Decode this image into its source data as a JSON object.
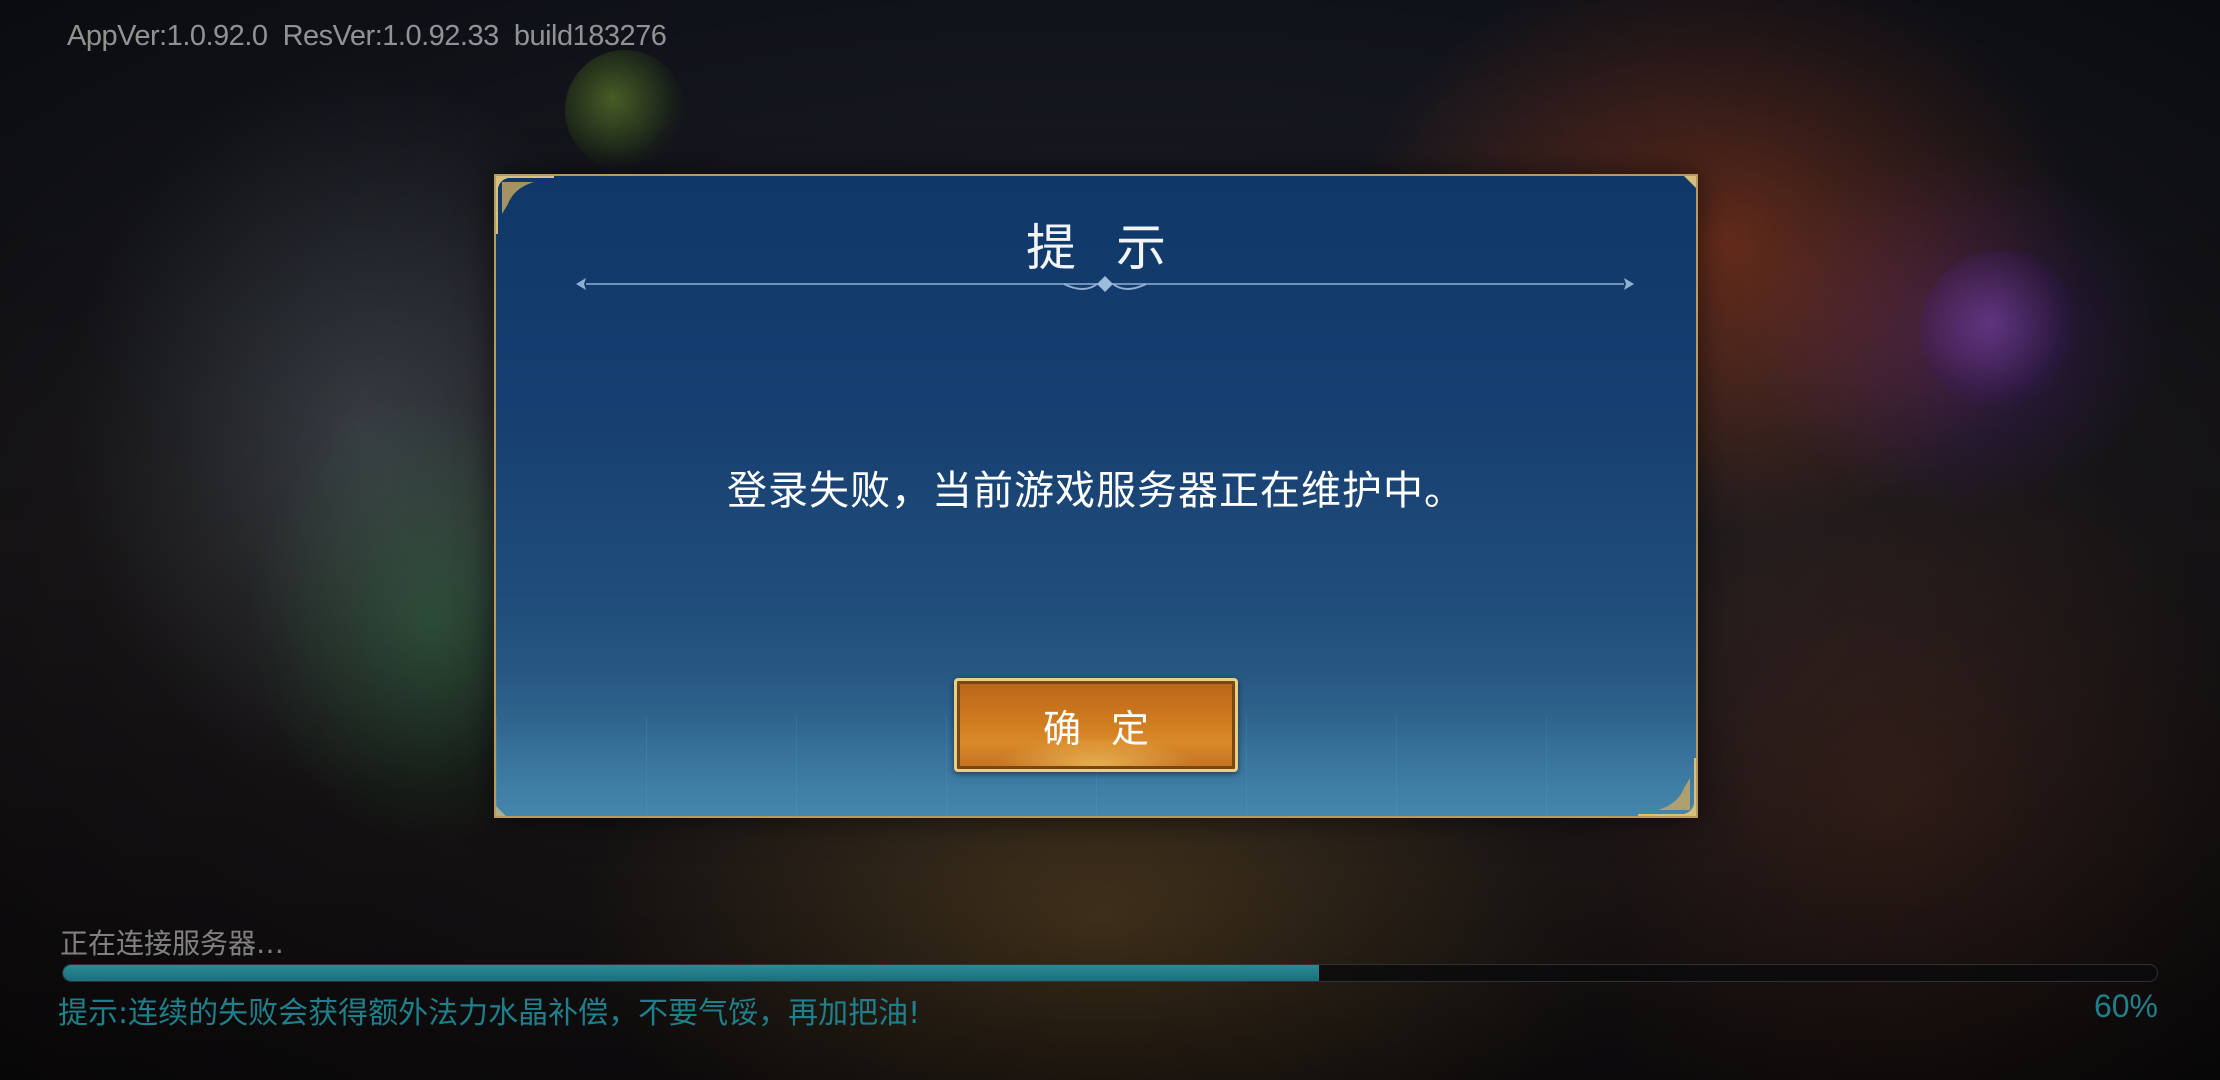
{
  "version_info": "AppVer:1.0.92.0  ResVer:1.0.92.33  build183276",
  "dialog": {
    "title": "提示",
    "message": "登录失败，当前游戏服务器正在维护中。",
    "confirm_label": "确定"
  },
  "loading": {
    "status": "正在连接服务器…",
    "progress": 0.6,
    "tip": "提示:连续的失败会获得额外法力水晶补偿，不要气馁，再加把油!",
    "percent_label": "60%"
  },
  "colors": {
    "dialog_bg": "#163e70",
    "dialog_border": "#b89a5f",
    "button_orange": "#cf7a1f",
    "progress_teal": "#2b8a96",
    "tip_teal": "#1f7f8a"
  }
}
